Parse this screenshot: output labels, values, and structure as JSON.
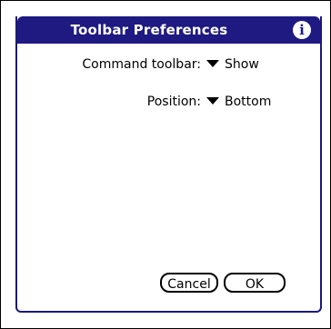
{
  "dialog": {
    "title": "Toolbar Preferences",
    "info_icon": "info-icon",
    "info_glyph": "i"
  },
  "fields": {
    "command_toolbar": {
      "label": "Command toolbar:",
      "value": "Show"
    },
    "position": {
      "label": "Position:",
      "value": "Bottom"
    }
  },
  "buttons": {
    "cancel": "Cancel",
    "ok": "OK"
  },
  "colors": {
    "titlebar": "#1e1a82",
    "frame": "#1a1a7a"
  }
}
